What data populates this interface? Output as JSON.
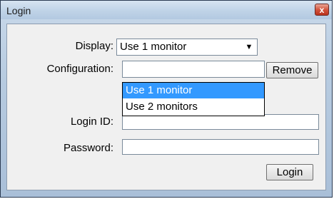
{
  "window": {
    "title": "Login",
    "close_glyph": "x"
  },
  "form": {
    "display_label": "Display:",
    "display_value": "Use 1 monitor",
    "display_options": [
      "Use 1 monitor",
      "Use 2 monitors"
    ],
    "configuration_label": "Configuration:",
    "remove_label": "Remove",
    "login_id_label": "Login ID:",
    "login_id_value": "",
    "password_label": "Password:",
    "password_value": "",
    "login_button_label": "Login"
  },
  "icons": {
    "close": "close-icon",
    "dropdown_arrow": "chevron-down-icon"
  },
  "colors": {
    "selected_bg": "#3399ff",
    "selected_fg": "#ffffff",
    "close_red": "#d2553e"
  }
}
